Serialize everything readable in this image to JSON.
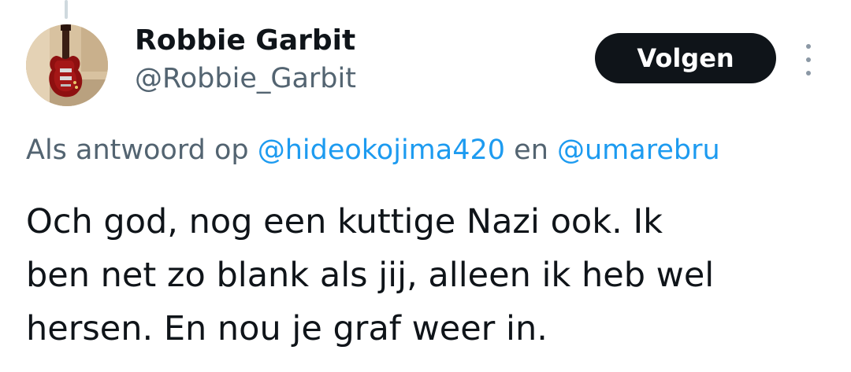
{
  "author": {
    "display_name": "Robbie Garbit",
    "handle": "@Robbie_Garbit",
    "avatar_icon": "guitar-photo-avatar"
  },
  "actions": {
    "follow_label": "Volgen",
    "more_icon": "more-vertical-icon"
  },
  "reply_context": {
    "prefix": "Als antwoord op ",
    "mention_1": "@hideokojima420",
    "joiner": " en ",
    "mention_2": "@umarebru"
  },
  "tweet": {
    "lines": [
      "Och god, nog een kuttige Nazi ook. Ik",
      "ben net zo blank als jij, alleen ik heb wel",
      "hersen. En nou je graf weer in."
    ]
  },
  "colors": {
    "text": "#0f1419",
    "secondary": "#536471",
    "link": "#1d9bf0",
    "button_bg": "#0f1419",
    "button_text": "#ffffff"
  }
}
